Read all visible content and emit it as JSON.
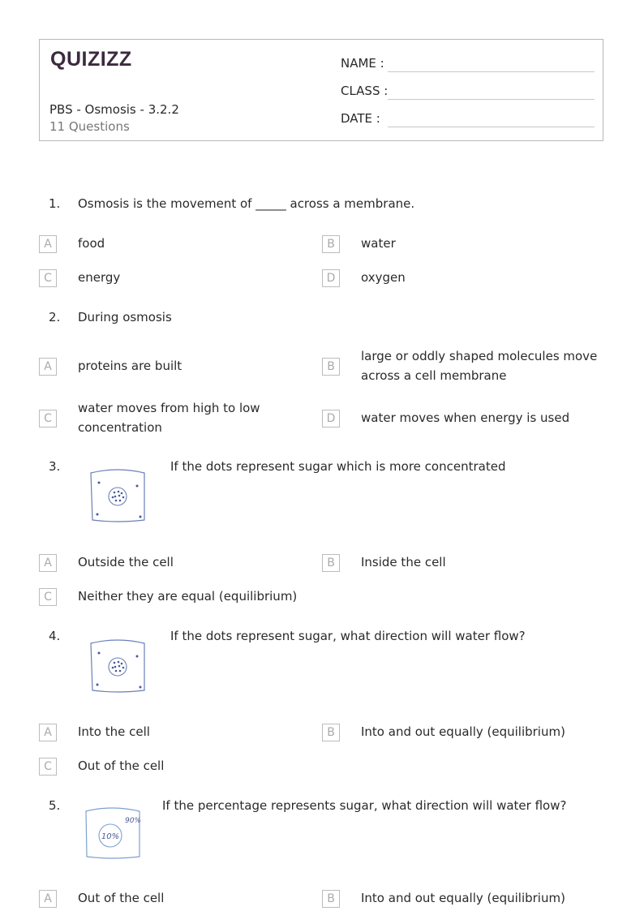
{
  "header": {
    "logo": "QUIZIZZ",
    "title": "PBS - Osmosis - 3.2.2",
    "count": "11 Questions",
    "fields": [
      "NAME :",
      "CLASS :",
      "DATE  :"
    ]
  },
  "questions": [
    {
      "num": "1.",
      "text": "Osmosis is the movement of _____ across a membrane.",
      "options": [
        {
          "letter": "A",
          "text": "food"
        },
        {
          "letter": "B",
          "text": "water"
        },
        {
          "letter": "C",
          "text": "energy"
        },
        {
          "letter": "D",
          "text": "oxygen"
        }
      ]
    },
    {
      "num": "2.",
      "text": "During osmosis",
      "options": [
        {
          "letter": "A",
          "text": "proteins are built"
        },
        {
          "letter": "B",
          "text": "large or oddly shaped molecules move across a cell membrane"
        },
        {
          "letter": "C",
          "text": "water moves from high to low concentration"
        },
        {
          "letter": "D",
          "text": "water moves when energy is used"
        }
      ]
    },
    {
      "num": "3.",
      "text": "If the dots represent sugar which is more concentrated",
      "image": "cell-diagram-dots",
      "options": [
        {
          "letter": "A",
          "text": "Outside the cell"
        },
        {
          "letter": "B",
          "text": "Inside the cell"
        },
        {
          "letter": "C",
          "text": "Neither they are equal (equilibrium)"
        }
      ]
    },
    {
      "num": "4.",
      "text": "If the dots represent sugar, what direction will water flow?",
      "image": "cell-diagram-dots",
      "options": [
        {
          "letter": "A",
          "text": "Into the cell"
        },
        {
          "letter": "B",
          "text": "Into and out equally (equilibrium)"
        },
        {
          "letter": "C",
          "text": "Out of the cell"
        }
      ]
    },
    {
      "num": "5.",
      "text": "If the percentage represents sugar, what direction will water flow?",
      "image": "cell-diagram-percent",
      "image_labels": {
        "outside": "90%",
        "inside": "10%"
      },
      "options": [
        {
          "letter": "A",
          "text": "Out of the cell"
        },
        {
          "letter": "B",
          "text": "Into and out equally (equilibrium)"
        }
      ]
    }
  ]
}
